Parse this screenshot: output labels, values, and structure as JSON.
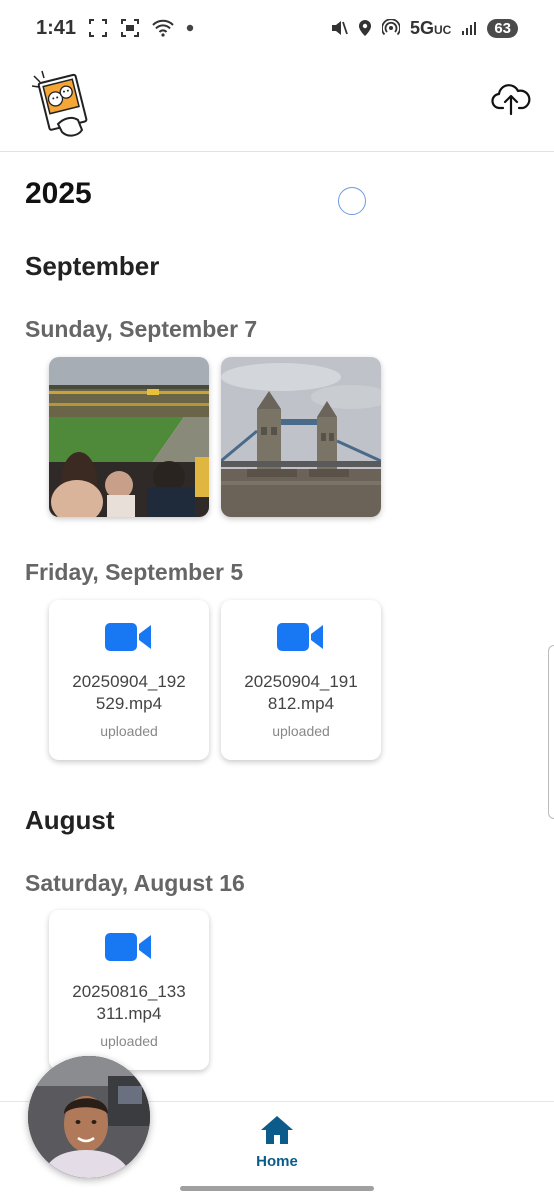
{
  "status_bar": {
    "time": "1:41",
    "network": "5G",
    "network_suffix": "UC",
    "battery": "63"
  },
  "header": {
    "upload_icon": "cloud-upload-icon",
    "logo": "app-logo"
  },
  "timeline": {
    "year": "2025",
    "months": [
      {
        "label": "September",
        "days": [
          {
            "label": "Sunday, September 7",
            "items": [
              {
                "kind": "photo",
                "subject": "stadium"
              },
              {
                "kind": "photo",
                "subject": "tower-bridge"
              }
            ]
          },
          {
            "label": "Friday, September 5",
            "items": [
              {
                "kind": "video",
                "name": "20250904_192529.mp4",
                "status": "uploaded"
              },
              {
                "kind": "video",
                "name": "20250904_191812.mp4",
                "status": "uploaded"
              }
            ]
          }
        ]
      },
      {
        "label": "August",
        "days": [
          {
            "label": "Saturday, August 16",
            "items": [
              {
                "kind": "video",
                "name": "20250816_133311.mp4",
                "status": "uploaded"
              }
            ]
          }
        ]
      }
    ]
  },
  "bottom_nav": {
    "home_label": "Home",
    "home_icon": "home-icon"
  },
  "colors": {
    "video_icon": "#1877f2",
    "nav_active": "#0b5c8a",
    "spinner": "#6d9be0"
  }
}
